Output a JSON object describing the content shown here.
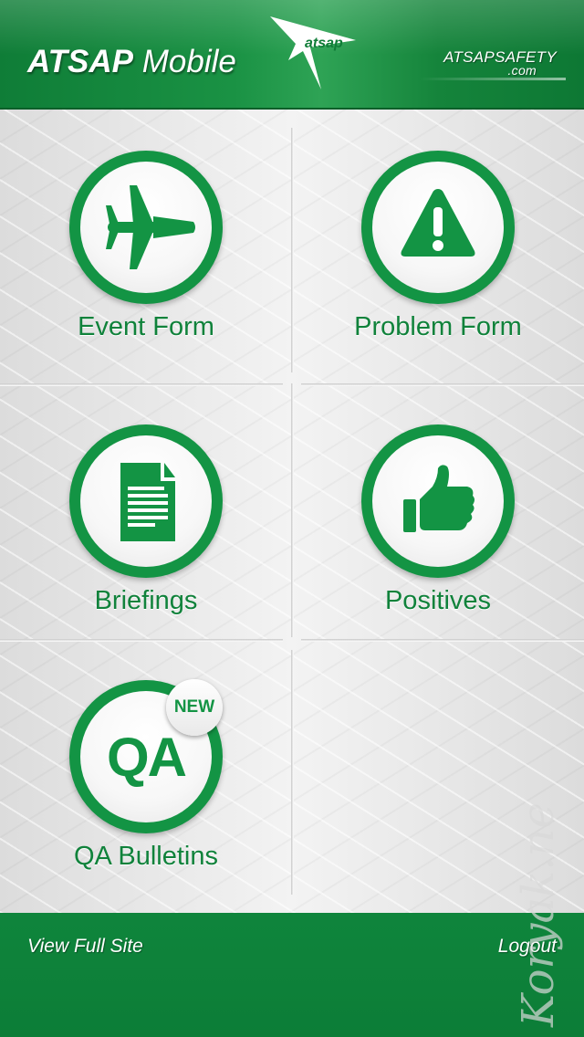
{
  "header": {
    "title_bold": "ATSAP",
    "title_rest": "Mobile",
    "logo_text": "atsap",
    "site_name": "ATSAPSAFETY",
    "site_suffix": ".com"
  },
  "tiles": [
    {
      "label": "Event Form",
      "icon": "airplane-icon"
    },
    {
      "label": "Problem Form",
      "icon": "warning-icon"
    },
    {
      "label": "Briefings",
      "icon": "document-icon"
    },
    {
      "label": "Positives",
      "icon": "thumbs-up-icon"
    },
    {
      "label": "QA Bulletins",
      "icon": "qa-icon",
      "icon_text": "QA",
      "badge": "NEW"
    }
  ],
  "footer": {
    "left_link": "View Full Site",
    "right_link": "Logout"
  },
  "watermark": "Koryak.net",
  "colors": {
    "brand_green": "#139444",
    "label_green": "#10823b",
    "footer_green": "#0c7d37"
  }
}
